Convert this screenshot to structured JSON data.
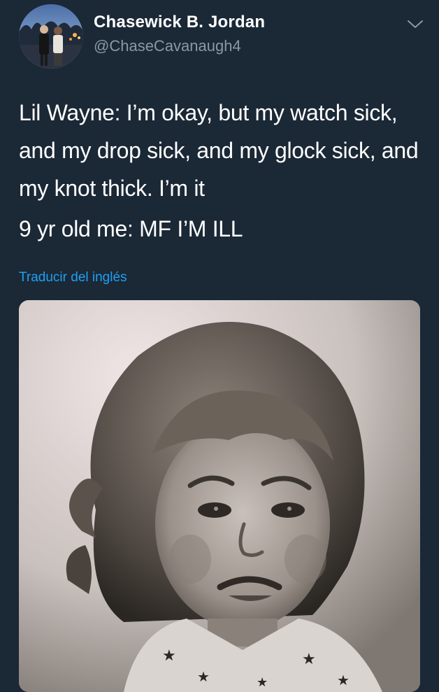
{
  "tweet": {
    "author": {
      "display_name": "Chasewick B. Jordan",
      "handle": "@ChaseCavanaugh4",
      "avatar_icon": "profile-photo-couple"
    },
    "menu_icon": "chevron-down-icon",
    "text_lines": [
      "Lil Wayne: I’m okay, but my watch sick, and my drop sick, and my glock sick, and my knot thick. I’m it",
      "9 yr old me: MF I’M ILL"
    ],
    "translate_link": "Traducir del inglés",
    "media": {
      "type": "photo",
      "content": "black-and-white photo of a grimacing toddler"
    }
  },
  "colors": {
    "background": "#1b2836",
    "text_primary": "#ffffff",
    "text_secondary": "#8899a6",
    "link": "#1da1f2"
  }
}
